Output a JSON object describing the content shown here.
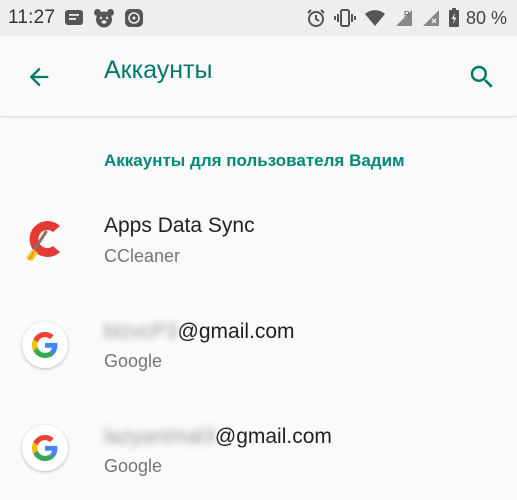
{
  "status_bar": {
    "time": "11:27",
    "battery_percent": "80 %",
    "icons": [
      "message-icon",
      "bear-icon",
      "app-icon",
      "alarm-icon",
      "vibrate-icon",
      "wifi-icon",
      "signal-r-icon",
      "signal-icon",
      "battery-icon"
    ]
  },
  "app_bar": {
    "title": "Аккаунты",
    "back_icon": "arrow-back-icon",
    "search_icon": "search-icon"
  },
  "section": {
    "header": "Аккаунты для пользователя Вадим"
  },
  "accounts": [
    {
      "title": "Apps Data Sync",
      "subtitle": "CCleaner",
      "icon": "ccleaner-icon"
    },
    {
      "title_hidden": "blzvcP3",
      "title_suffix": "@gmail.com",
      "subtitle": "Google",
      "icon": "google-icon"
    },
    {
      "title_hidden": "lazyanimal3",
      "title_suffix": "@gmail.com",
      "subtitle": "Google",
      "icon": "google-icon"
    }
  ],
  "colors": {
    "accent": "#00897b",
    "title": "#00796b",
    "background": "#fafafa",
    "status_bar": "#eeeeee"
  }
}
